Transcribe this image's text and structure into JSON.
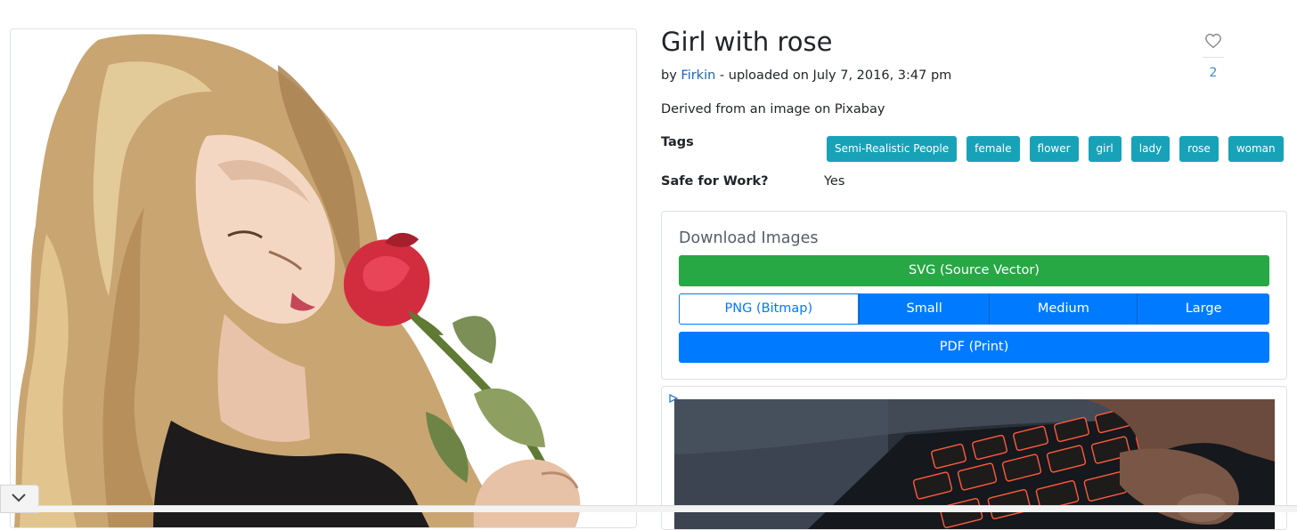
{
  "artwork": {
    "title": "Girl with rose",
    "byline_prefix": "by",
    "author": "Firkin",
    "uploaded_text": "- uploaded on July 7, 2016, 3:47 pm",
    "description": "Derived from an image on Pixabay",
    "favorite_icon": "heart-icon",
    "favorite_count": "2",
    "image_subject": "illustration-girl-smelling-red-rose"
  },
  "meta": {
    "tags_label": "Tags",
    "tags": [
      "Semi-Realistic People",
      "female",
      "flower",
      "girl",
      "lady",
      "rose",
      "woman"
    ],
    "sfw_label": "Safe for Work?",
    "sfw_value": "Yes"
  },
  "download": {
    "title": "Download Images",
    "svg_label": "SVG (Source Vector)",
    "png_label": "PNG (Bitmap)",
    "sizes": [
      "Small",
      "Medium",
      "Large"
    ],
    "pdf_label": "PDF (Print)"
  },
  "ad": {
    "choices_icon": "ad-choices-icon",
    "image_subject": "laptop-keyboard-red-backlight"
  },
  "collapse": {
    "icon": "chevron-down-icon"
  },
  "colors": {
    "tag": "#17a2b8",
    "success": "#28a745",
    "primary": "#007bff",
    "link": "#1f63b8",
    "favorite_count": "#3d8bd6"
  }
}
